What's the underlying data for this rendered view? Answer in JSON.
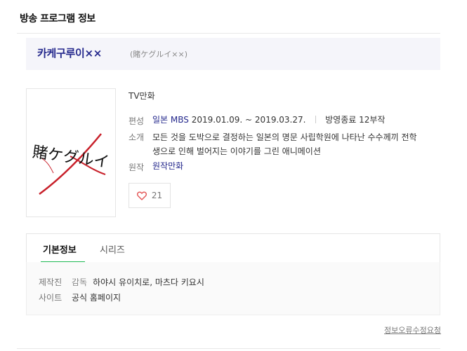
{
  "page": {
    "heading": "방송 프로그램 정보"
  },
  "program": {
    "title": "카케구루이××",
    "original_title": "(賭ケグルイ××)",
    "category": "TV만화",
    "poster_text": "賭ケグルイ"
  },
  "info": {
    "broadcast_label": "편성",
    "network": "일본 MBS",
    "period": "2019.01.09. ~ 2019.03.27.",
    "status": "방영종료 12부작",
    "intro_label": "소개",
    "intro_line1": "모든 것을 도박으로 결정하는 일본의 명문 사립학원에 나타난 수수께끼 전학",
    "intro_line2": "생으로 인해 벌어지는 이야기를 그린 애니메이션",
    "original_label": "원작",
    "original_work": "원작만화"
  },
  "like": {
    "count": "21"
  },
  "tabs": [
    {
      "label": "기본정보"
    },
    {
      "label": "시리즈"
    }
  ],
  "details": {
    "production_label": "제작진",
    "director_label": "감독",
    "directors": "하야시 유이치로, 마츠다 키요시",
    "site_label": "사이트",
    "site_link": "공식 홈페이지"
  },
  "footer": {
    "report_link": "정보오류수정요청"
  },
  "colors": {
    "accent_navy": "#24288c",
    "tab_active": "#1db954",
    "heart": "#e35454"
  },
  "icons": {
    "like": "heart-icon"
  }
}
